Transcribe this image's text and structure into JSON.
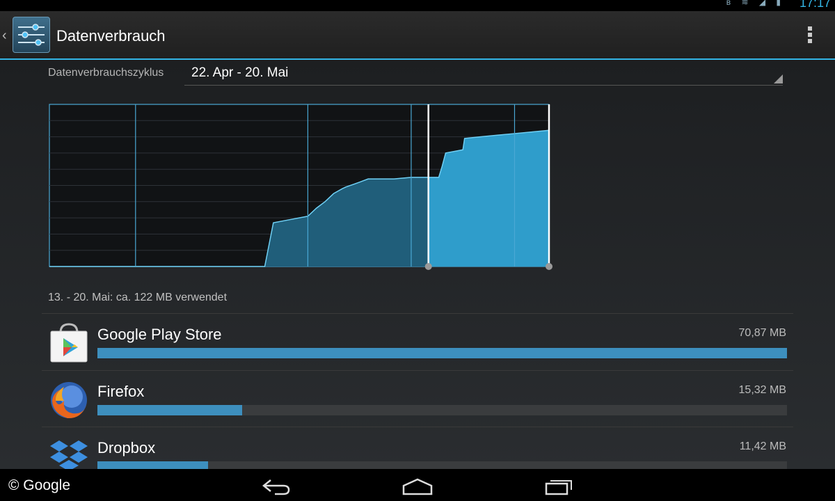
{
  "status_bar": {
    "time": "17:17",
    "icons": [
      "bluetooth-icon",
      "wifi-icon",
      "signal-icon",
      "battery-icon"
    ]
  },
  "action_bar": {
    "title": "Datenverbrauch",
    "back_glyph": "‹",
    "icon": "settings-sliders-icon",
    "overflow": "overflow-menu-icon"
  },
  "cycle": {
    "label": "Datenverbrauchszyklus",
    "value": "22. Apr - 20. Mai"
  },
  "colors": {
    "accent": "#33b5e5",
    "bar": "#3d8fbe",
    "area_selected": "#2f9dcb",
    "area_unselected": "#205e7a"
  },
  "chart_data": {
    "type": "area",
    "title": "",
    "xlabel": "",
    "ylabel": "",
    "cycle_days": 29,
    "grid": true,
    "series": [
      {
        "x": [
          0,
          12.5,
          13.0,
          14.0,
          15.0,
          15.5,
          16.0,
          16.5,
          17.0,
          17.2,
          18.0,
          18.5,
          20.0,
          21.0,
          22.0,
          22.6,
          22.8,
          23.0,
          24.0,
          24.1,
          25.0,
          26.0,
          27.0,
          28.0,
          29.0
        ],
        "y": [
          0,
          0,
          27,
          29,
          31,
          36,
          40,
          45,
          48,
          49,
          52,
          54,
          54,
          55,
          55,
          55,
          62,
          70,
          72,
          79,
          80,
          81,
          82,
          83,
          84
        ]
      }
    ],
    "selection": {
      "start_day": 22,
      "end_day": 29
    },
    "ylim": [
      0,
      100
    ],
    "xlim": [
      0,
      29
    ]
  },
  "usage_summary": "13. - 20. Mai: ca. 122 MB verwendet",
  "apps": [
    {
      "name": "Google Play Store",
      "size": "70,87 MB",
      "fraction": 1.0,
      "icon": "play-store-icon"
    },
    {
      "name": "Firefox",
      "size": "15,32 MB",
      "fraction": 0.21,
      "icon": "firefox-icon"
    },
    {
      "name": "Dropbox",
      "size": "11,42 MB",
      "fraction": 0.16,
      "icon": "dropbox-icon"
    }
  ],
  "nav": {
    "copyright": "© Google",
    "buttons": [
      "back-icon",
      "home-icon",
      "recent-apps-icon"
    ]
  }
}
